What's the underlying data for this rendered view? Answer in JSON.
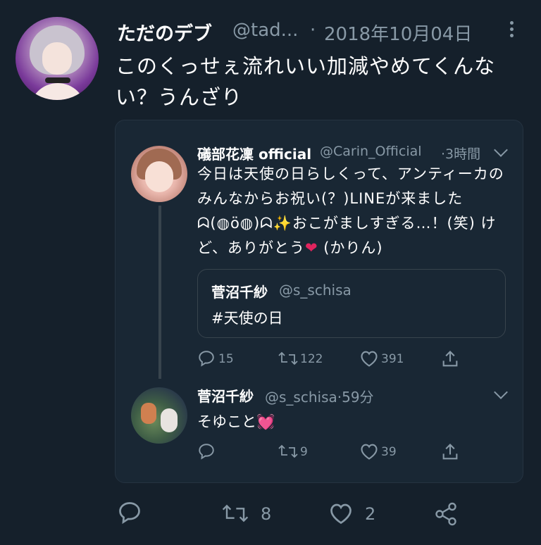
{
  "tweet": {
    "display_name": "ただのデブ",
    "handle": "@tad...",
    "separator": "·",
    "date": "2018年10月04日",
    "text": "このくっせぇ流れいい加減やめてくんない？うんざり",
    "actions": {
      "retweets": "8",
      "likes": "2"
    }
  },
  "quoted_tweet": {
    "display_name": "礒部花凜 official",
    "handle": "@Carin_Official",
    "time": "·3時間",
    "text_pre": "今日は天使の日らしくって、アンティーカのみんなからお祝い(？)LINEが来ました ᗣ(◍ö◍)ᗣ✨おこがましすぎる…！(笑) けど、ありがとう",
    "emoji_heart": "❤",
    "text_post": " (かりん)",
    "nested_quote": {
      "display_name": "菅沼千紗",
      "handle": "@s_schisa",
      "text": "#天使の日"
    },
    "actions": {
      "replies": "15",
      "retweets": "122",
      "likes": "391"
    }
  },
  "reply_tweet": {
    "display_name": "菅沼千紗",
    "handle": "@s_schisa",
    "time": "·59分",
    "text": "そゆこと",
    "emoji": "💓",
    "actions": {
      "retweets": "9",
      "likes": "39"
    }
  },
  "icons": {
    "reply": "reply-icon",
    "retweet": "retweet-icon",
    "like": "heart-icon",
    "share": "share-icon",
    "more": "more-icon",
    "chevron": "chevron-down-icon"
  },
  "colors": {
    "background": "#15202b",
    "card": "#192734",
    "secondary_text": "#8899a6",
    "border": "#38444d"
  }
}
